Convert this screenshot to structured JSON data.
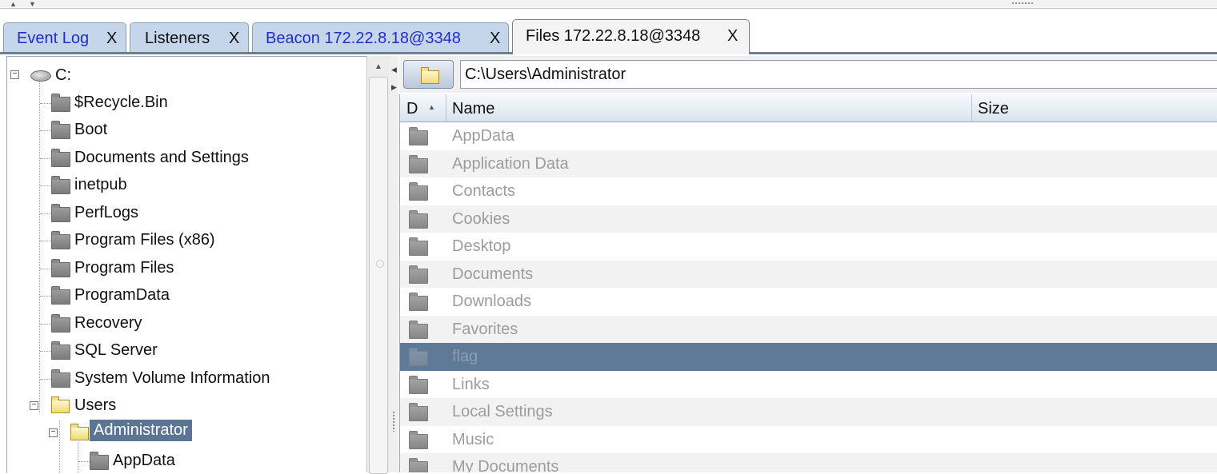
{
  "tabs": [
    {
      "label": "Event Log",
      "close": "X",
      "color": "blue"
    },
    {
      "label": "Listeners",
      "close": "X",
      "color": "black"
    },
    {
      "label": "Beacon 172.22.8.18@3348",
      "close": "X",
      "color": "blue"
    },
    {
      "label": "Files 172.22.8.18@3348",
      "close": "X",
      "color": "black",
      "active": true
    }
  ],
  "tree": {
    "drive": "C:",
    "folders": [
      "$Recycle.Bin",
      "Boot",
      "Documents and Settings",
      "inetpub",
      "PerfLogs",
      "Program Files (x86)",
      "Program Files",
      "ProgramData",
      "Recovery",
      "SQL Server",
      "System Volume Information",
      "Users"
    ],
    "users_children": [
      "Administrator"
    ],
    "administrator_children": [
      "AppData"
    ],
    "selected": "Administrator"
  },
  "path": {
    "value": "C:\\Users\\Administrator"
  },
  "table": {
    "headers": {
      "d": "D",
      "name": "Name",
      "size": "Size"
    },
    "rows": [
      {
        "name": "AppData"
      },
      {
        "name": "Application Data"
      },
      {
        "name": "Contacts"
      },
      {
        "name": "Cookies"
      },
      {
        "name": "Desktop"
      },
      {
        "name": "Documents"
      },
      {
        "name": "Downloads"
      },
      {
        "name": "Favorites"
      },
      {
        "name": "flag",
        "selected": true
      },
      {
        "name": "Links"
      },
      {
        "name": "Local Settings"
      },
      {
        "name": "Music"
      },
      {
        "name": "My Documents"
      }
    ]
  },
  "colors": {
    "selection": "#5b7694",
    "tab_inactive_bg": "#c6d6ea",
    "tab_link_text": "#1f2fc4"
  }
}
